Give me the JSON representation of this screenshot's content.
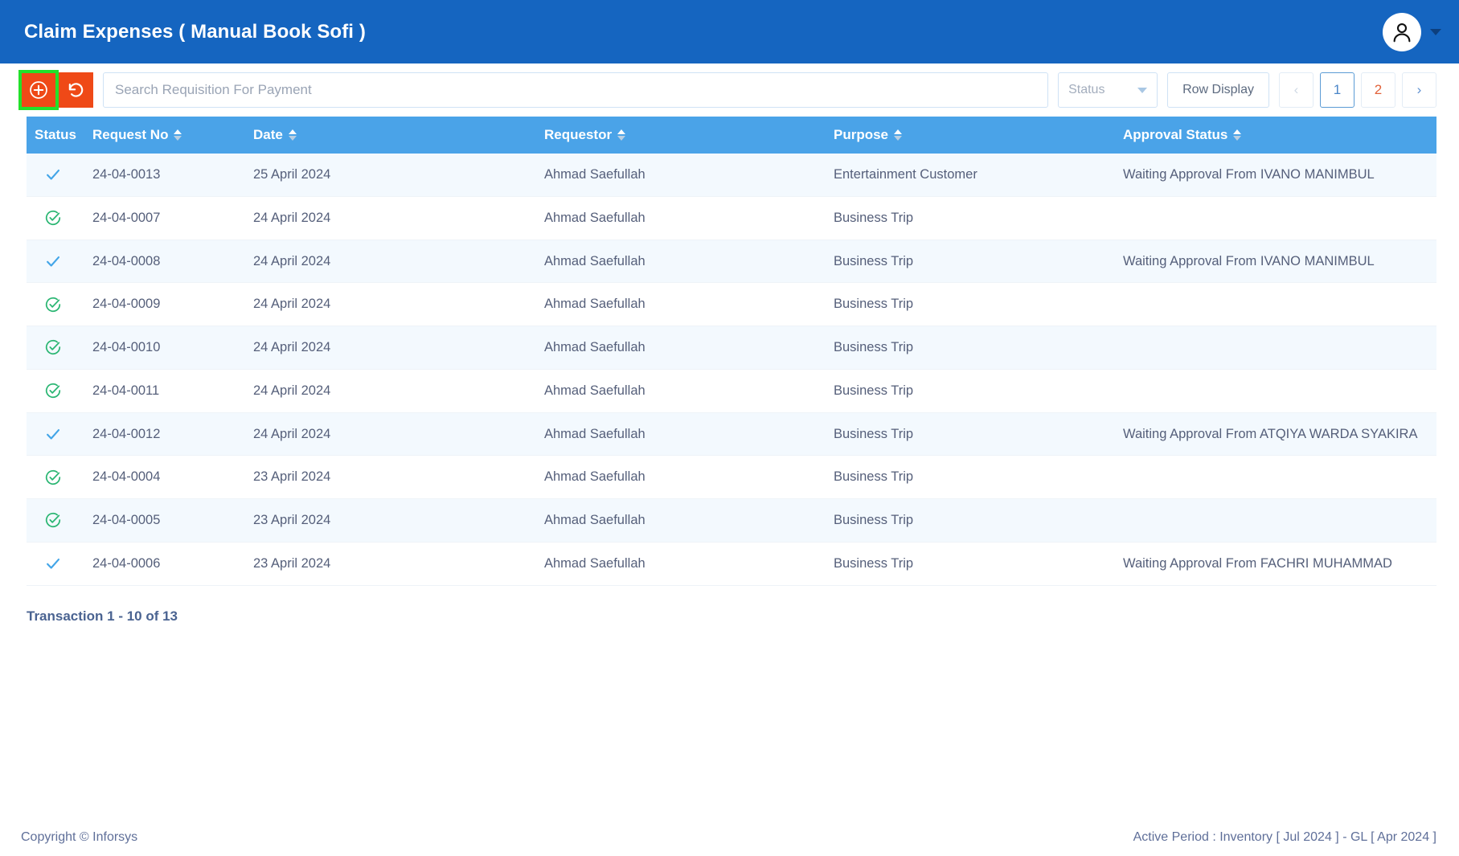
{
  "header": {
    "title": "Claim Expenses ( Manual Book Sofi )",
    "avatar_icon": "user-avatar-icon",
    "caret_icon": "chevron-down-icon"
  },
  "toolbar": {
    "add_icon": "plus-circle-icon",
    "refresh_icon": "refresh-undo-icon",
    "search": {
      "placeholder": "Search Requisition For Payment",
      "value": ""
    },
    "status_filter": {
      "label": "Status",
      "icon": "chevron-down-icon"
    },
    "row_display_label": "Row Display",
    "pagination": {
      "prev_label": "‹",
      "next_label": "›",
      "pages": [
        "1",
        "2"
      ],
      "current_page": "1"
    }
  },
  "table": {
    "columns": [
      {
        "label": "Status",
        "sortable": false
      },
      {
        "label": "Request No",
        "sortable": true
      },
      {
        "label": "Date",
        "sortable": true
      },
      {
        "label": "Requestor",
        "sortable": true
      },
      {
        "label": "Purpose",
        "sortable": true
      },
      {
        "label": "Approval Status",
        "sortable": true
      }
    ],
    "rows": [
      {
        "status_icon": "check-blue-icon",
        "request_no": "24-04-0013",
        "date": "25 April 2024",
        "requestor": "Ahmad Saefullah",
        "purpose": "Entertainment Customer",
        "approval_status": "Waiting Approval From IVANO MANIMBUL"
      },
      {
        "status_icon": "check-circle-green-icon",
        "request_no": "24-04-0007",
        "date": "24 April 2024",
        "requestor": "Ahmad Saefullah",
        "purpose": "Business Trip",
        "approval_status": ""
      },
      {
        "status_icon": "check-blue-icon",
        "request_no": "24-04-0008",
        "date": "24 April 2024",
        "requestor": "Ahmad Saefullah",
        "purpose": "Business Trip",
        "approval_status": "Waiting Approval From IVANO MANIMBUL"
      },
      {
        "status_icon": "check-circle-green-icon",
        "request_no": "24-04-0009",
        "date": "24 April 2024",
        "requestor": "Ahmad Saefullah",
        "purpose": "Business Trip",
        "approval_status": ""
      },
      {
        "status_icon": "check-circle-green-icon",
        "request_no": "24-04-0010",
        "date": "24 April 2024",
        "requestor": "Ahmad Saefullah",
        "purpose": "Business Trip",
        "approval_status": ""
      },
      {
        "status_icon": "check-circle-green-icon",
        "request_no": "24-04-0011",
        "date": "24 April 2024",
        "requestor": "Ahmad Saefullah",
        "purpose": "Business Trip",
        "approval_status": ""
      },
      {
        "status_icon": "check-blue-icon",
        "request_no": "24-04-0012",
        "date": "24 April 2024",
        "requestor": "Ahmad Saefullah",
        "purpose": "Business Trip",
        "approval_status": "Waiting Approval From ATQIYA WARDA SYAKIRA"
      },
      {
        "status_icon": "check-circle-green-icon",
        "request_no": "24-04-0004",
        "date": "23 April 2024",
        "requestor": "Ahmad Saefullah",
        "purpose": "Business Trip",
        "approval_status": ""
      },
      {
        "status_icon": "check-circle-green-icon",
        "request_no": "24-04-0005",
        "date": "23 April 2024",
        "requestor": "Ahmad Saefullah",
        "purpose": "Business Trip",
        "approval_status": ""
      },
      {
        "status_icon": "check-blue-icon",
        "request_no": "24-04-0006",
        "date": "23 April 2024",
        "requestor": "Ahmad Saefullah",
        "purpose": "Business Trip",
        "approval_status": "Waiting Approval From FACHRI MUHAMMAD"
      }
    ]
  },
  "summary": {
    "transaction_count_label": "Transaction 1 - 10 of 13"
  },
  "footer": {
    "copyright": "Copyright © Inforsys",
    "active_period": "Active Period  :  Inventory [ Jul 2024 ]  -  GL [ Apr 2024 ]"
  },
  "colors": {
    "header_blue": "#1565c0",
    "table_header_blue": "#4aa3e8",
    "accent_orange": "#ef4917",
    "highlight_green": "#22e12a",
    "status_check_blue": "#42a5e8",
    "status_check_green": "#2bb673",
    "row_stripe": "#f3f9fe",
    "text_slate": "#555f7a"
  }
}
